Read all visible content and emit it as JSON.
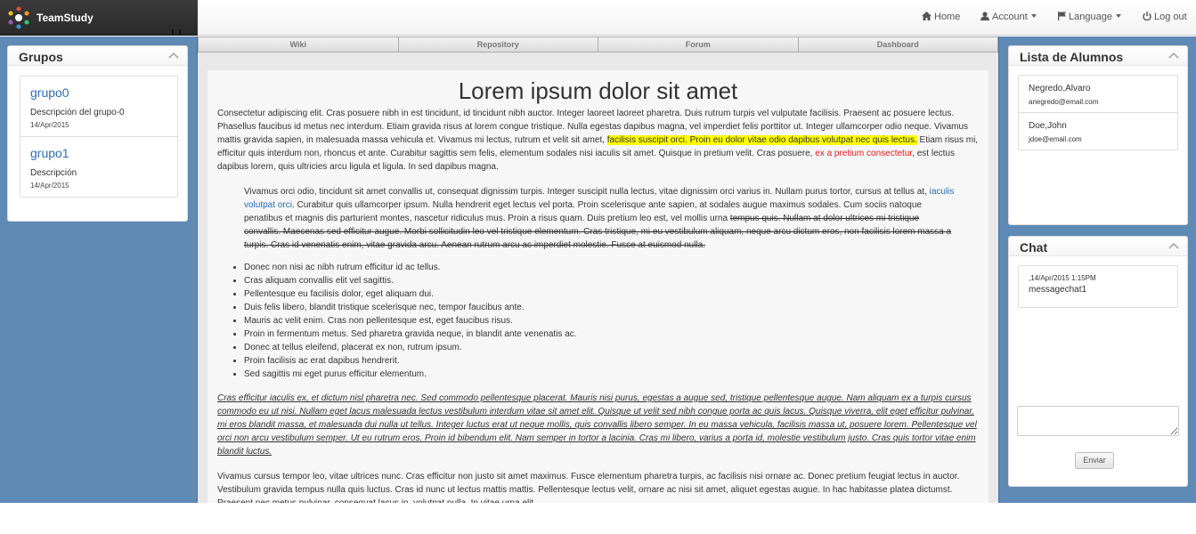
{
  "brand": {
    "name": "TeamStudy"
  },
  "nav": {
    "home": "Home",
    "account": "Account",
    "language": "Language",
    "logout": "Log out"
  },
  "tabs": [
    "Wiki",
    "Repository",
    "Forum",
    "Dashboard"
  ],
  "grupos": {
    "title": "Grupos",
    "items": [
      {
        "name": "grupo0",
        "description": "Descripción del grupo-0",
        "date": "14/Apr/2015"
      },
      {
        "name": "grupo1",
        "description": "Descripción",
        "date": "14/Apr/2015"
      }
    ]
  },
  "alumnos": {
    "title": "Lista de Alumnos",
    "items": [
      {
        "name": "Negredo,Alvaro",
        "email": "anegredo@email.com"
      },
      {
        "name": "Doe,John",
        "email": "jdoe@email.com"
      }
    ]
  },
  "chat": {
    "title": "Chat",
    "messages": [
      {
        "time": ",14/Apr/2015 1:15PM",
        "text": "messagechat1"
      }
    ],
    "send_label": "Enviar"
  },
  "article": {
    "title": "Lorem ipsum dolor sit amet",
    "p1": {
      "a": "Consectetur adipiscing elit. Cras posuere nibh in est tincidunt, id tincidunt nibh auctor. Integer laoreet laoreet pharetra. Duis rutrum turpis vel vulputate facilisis. Praesent ac posuere lectus. Phasellus faucibus id metus nec interdum. Etiam gravida risus at lorem congue tristique. Nulla egestas dapibus magna, vel imperdiet felis porttitor ut. Integer ullamcorper odio neque. Vivamus mattis gravida sapien, in malesuada massa vehicula et. Vivamus mi lectus, rutrum et velit sit amet, ",
      "highlight": "facilisis suscipit orci. Proin eu dolor vitae odio dapibus volutpat nec quis lectus.",
      "b": " Etiam risus mi, efficitur quis interdum non, rhoncus et ante. Curabitur sagittis sem felis, elementum sodales nisi iaculis sit amet. Quisque in pretium velit. Cras posuere, ",
      "red": "ex a pretium consectetur",
      "c": ", est lectus dapibus lorem, quis ultricies arcu ligula et ligula. In sed dapibus magna."
    },
    "quote": {
      "a": "Vivamus orci odio, tincidunt sit amet convallis ut, consequat dignissim turpis. Integer suscipit nulla lectus, vitae dignissim orci varius in. Nullam purus tortor, cursus at tellus at, ",
      "link": "iaculis volutpat orci",
      "b": ". Curabitur quis ullamcorper ipsum. Nulla hendrerit eget lectus vel porta. Proin scelerisque ante sapien, at sodales augue maximus sodales. Cum sociis natoque penatibus et magnis dis parturient montes, nascetur ridiculus mus. Proin a risus quam. Duis pretium leo est, vel mollis urna ",
      "strike": "tempus quis. Nullam at dolor ultrices mi tristique convallis. Maecenas sed efficitur augue. Morbi sollicitudin leo vel tristique elementum. Cras tristique, mi eu vestibulum aliquam, neque arcu dictum eros, non facilisis lorem massa a turpis. Cras id venenatis enim, vitae gravida arcu. Aenean rutrum arcu ac imperdiet molestie. Fusce at euismod nulla."
    },
    "list": [
      "Donec non nisi ac nibh rutrum efficitur id ac tellus.",
      "Cras aliquam convallis elit vel sagittis.",
      "Pellentesque eu facilisis dolor, eget aliquam dui.",
      "Duis felis libero, blandit tristique scelerisque nec, tempor faucibus ante.",
      "Mauris ac velit enim. Cras non pellentesque est, eget faucibus risus.",
      "Proin in fermentum metus. Sed pharetra gravida neque, in blandit ante venenatis ac.",
      "Donec at tellus eleifend, placerat ex non, rutrum ipsum.",
      "Proin facilisis ac erat dapibus hendrerit.",
      "Sed sagittis mi eget purus efficitur elementum."
    ],
    "p2": "Cras efficitur iaculis ex, et dictum nisl pharetra nec. Sed commodo pellentesque placerat. Mauris nisi purus, egestas a augue sed, tristique pellentesque augue. Nam aliquam ex a turpis cursus commodo eu ut nisi. Nullam eget lacus malesuada lectus vestibulum interdum vitae sit amet elit. Quisque ut velit sed nibh congue porta ac quis lacus. Quisque viverra, elit eget efficitur pulvinar, mi eros blandit massa, et malesuada dui nulla ut tellus. Integer luctus erat ut neque mollis, quis convallis libero semper. In eu massa vehicula, facilisis massa ut, posuere lorem. Pellentesque vel orci non arcu vestibulum semper. Ut eu rutrum eros. Proin id bibendum elit. Nam semper in tortor a lacinia. Cras mi libero, varius a porta id, molestie vestibulum justo. Cras quis tortor vitae enim blandit luctus.",
    "p3": "Vivamus cursus tempor leo, vitae ultrices nunc. Cras efficitur non justo sit amet maximus. Fusce elementum pharetra turpis, ac facilisis nisi ornare ac. Donec pretium feugiat lectus in auctor. Vestibulum gravida tempus nulla quis luctus. Cras id nunc ut lectus mattis mattis. Pellentesque lectus velit, ornare ac nisi sit amet, aliquet egestas augue. In hac habitasse platea dictumst. Praesent nec metus pulvinar, consequat lacus in, volutpat nulla. In vitae urna elit."
  },
  "colors": {
    "sidebar_bg": "#5f8ab6",
    "link": "#2a6db5",
    "highlight": "#ffff00",
    "red_text": "#e02020",
    "brand_bar": "#2e2e2e"
  }
}
